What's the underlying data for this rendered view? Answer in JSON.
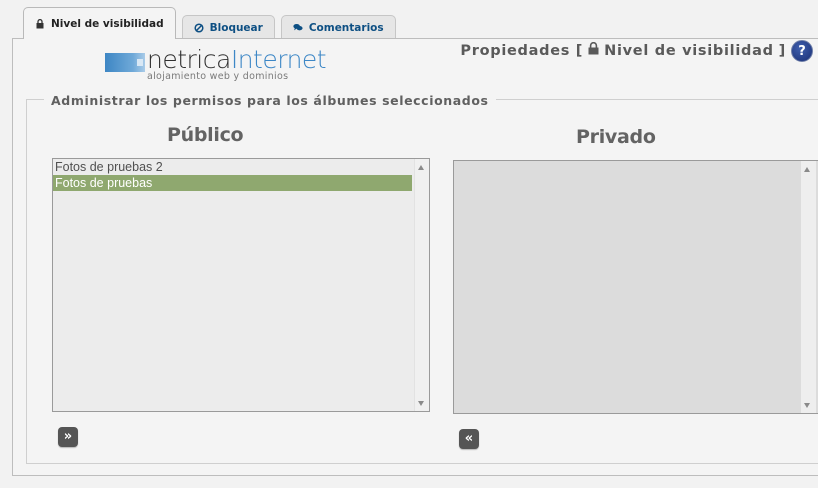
{
  "tabs": [
    {
      "label": "Nivel de visibilidad",
      "icon": "lock-icon",
      "active": true
    },
    {
      "label": "Bloquear",
      "icon": "block-icon",
      "active": false
    },
    {
      "label": "Comentarios",
      "icon": "comments-icon",
      "active": false
    }
  ],
  "logo": {
    "word_dark": "netrica",
    "word_blue": "Internet",
    "tagline": "alojamiento web y dominios"
  },
  "header": {
    "properties_prefix": "Propiedades [",
    "properties_section": "Nivel de visibilidad",
    "properties_suffix": "]",
    "help_label": "?"
  },
  "fieldset": {
    "legend": "Administrar los permisos para los álbumes seleccionados"
  },
  "public": {
    "title": "Público",
    "items": [
      {
        "label": "Fotos de pruebas 2",
        "selected": false
      },
      {
        "label": "Fotos de pruebas",
        "selected": true
      }
    ],
    "move_button": "»"
  },
  "private": {
    "title": "Privado",
    "items": [],
    "move_button": "«"
  },
  "colors": {
    "selection": "#8fa86f",
    "tab_text": "#0d4f83",
    "logo_blue": "#3d87c6",
    "help_bg": "#1a2f74"
  }
}
